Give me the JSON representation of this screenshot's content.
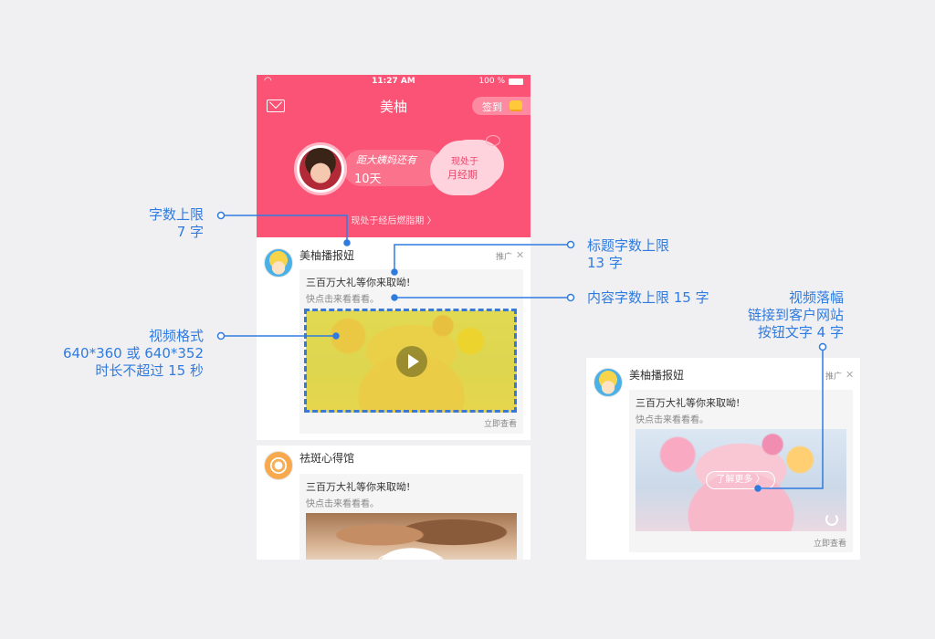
{
  "phone": {
    "status": {
      "time": "11:27 AM",
      "battery": "100 %"
    },
    "nav": {
      "title": "美柚",
      "checkin_label": "签到"
    },
    "hero": {
      "countdown_line1": "距大姨妈还有",
      "countdown_line2": "10天",
      "cloud_line1": "现处于",
      "cloud_line2": "月经期",
      "phase_link": "现处于经后燃脂期 〉"
    },
    "posts": [
      {
        "name": "美柚播报妞",
        "promo": "推广",
        "close": "✕",
        "title": "三百万大礼等你来取呦!",
        "content": "快点击来看看看。",
        "cta": "立即查看"
      },
      {
        "name": "祛斑心得馆",
        "title": "三百万大礼等你来取呦!",
        "content": "快点击来看看看。"
      }
    ]
  },
  "right_card": {
    "name": "美柚播报妞",
    "promo": "推广",
    "close": "✕",
    "title": "三百万大礼等你来取呦!",
    "content": "快点击来看看看。",
    "button": "了解更多 〉",
    "cta": "立即查看"
  },
  "annotations": {
    "name_limit": [
      "字数上限",
      "7 字"
    ],
    "title_limit": [
      "标题字数上限",
      "13 字"
    ],
    "content_limit": "内容字数上限 15 字",
    "video_format": [
      "视频格式",
      "640*360 或 640*352",
      "时长不超过 15 秒"
    ],
    "video_endcard": [
      "视频落幅",
      "链接到客户网站",
      "按钮文字 4 字"
    ]
  },
  "colors": {
    "brand": "#fb5375",
    "annotation": "#2f7be0",
    "highlight": "#e4d414"
  }
}
